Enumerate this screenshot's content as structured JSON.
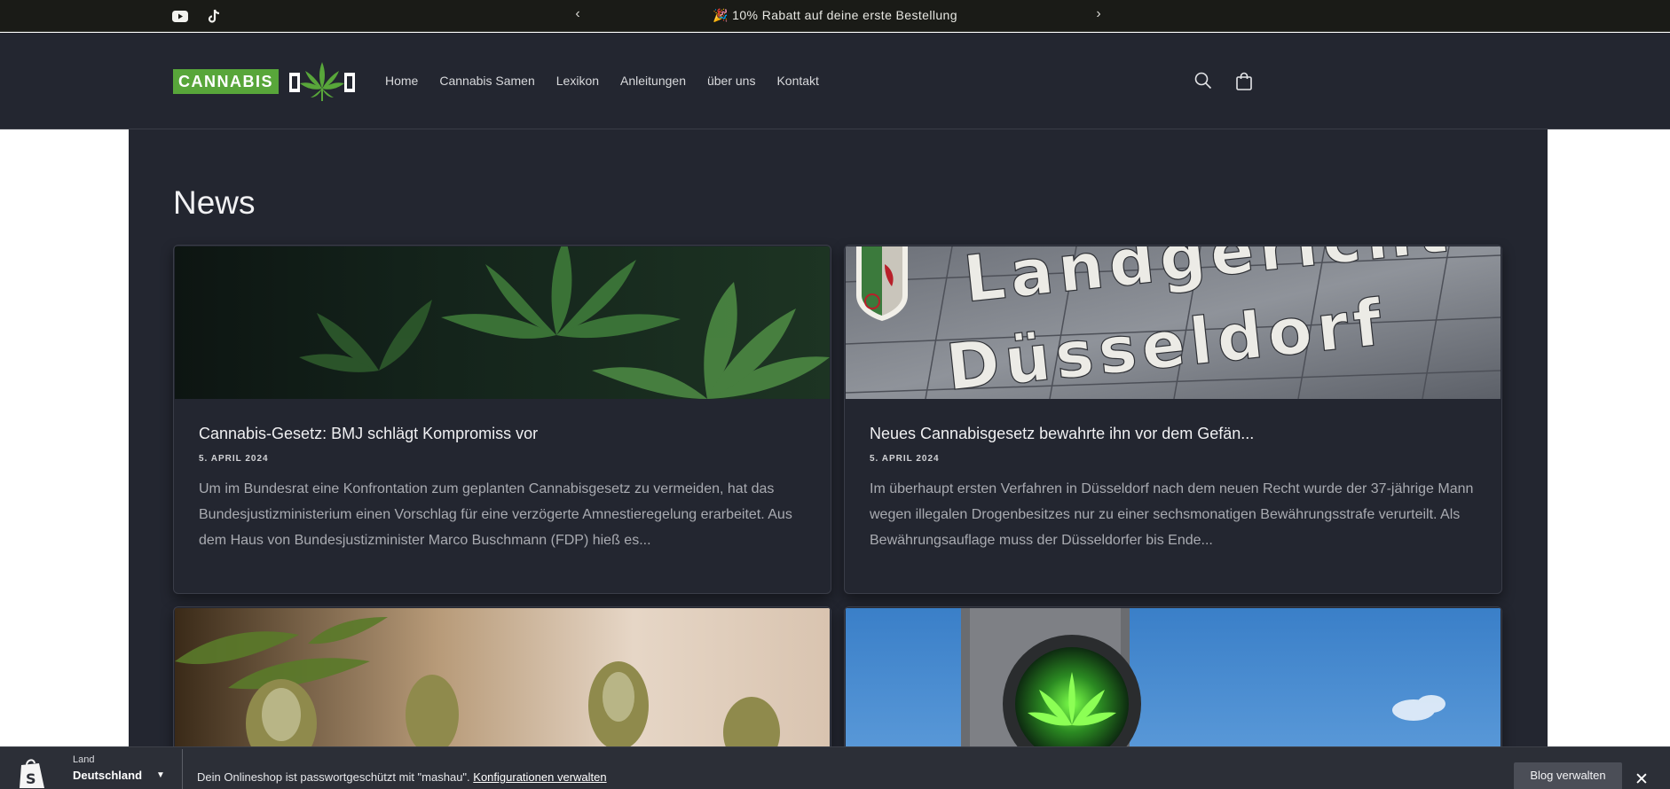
{
  "announcement": {
    "message": "🎉 10% Rabatt auf deine erste Bestellung",
    "prev_arrow": "‹",
    "next_arrow": "›",
    "social_icons": [
      "youtube-icon",
      "tiktok-icon"
    ]
  },
  "header": {
    "logo_text": "CANNABIS",
    "nav": [
      "Home",
      "Cannabis Samen",
      "Lexikon",
      "Anleitungen",
      "über uns",
      "Kontakt"
    ],
    "icons": [
      "search-icon",
      "cart-icon"
    ],
    "brand_color": "#58a63a"
  },
  "main": {
    "title": "News",
    "articles": [
      {
        "title": "Cannabis-Gesetz: BMJ schlägt Kompromiss vor",
        "date": "5. APRIL 2024",
        "excerpt": "Um im Bundesrat eine Konfrontation zum geplanten Cannabisgesetz zu vermeiden, hat das Bundesjustizministerium einen Vorschlag für eine verzögerte Amnestieregelung erarbeitet. Aus dem Haus von Bundesjustizminister Marco Buschmann (FDP) hieß es..."
      },
      {
        "title": "Neues Cannabisgesetz bewahrte ihn vor dem Gefän...",
        "date": "5. APRIL 2024",
        "excerpt": "Im überhaupt ersten Verfahren in Düsseldorf nach dem neuen Recht wurde der 37-jährige Mann wegen illegalen Drogenbesitzes nur zu einer sechsmonatigen Bewährungsstrafe verurteilt. Als Bewährungsauflage muss der Düsseldorfer bis Ende...",
        "image_text_line1": "Landgericht",
        "image_text_line2": "Düsseldorf"
      },
      {
        "title": "",
        "date": "",
        "excerpt": ""
      },
      {
        "title": "",
        "date": "",
        "excerpt": ""
      }
    ]
  },
  "shopify_bar": {
    "land_label": "Land",
    "country": "Deutschland",
    "password_text": "Dein Onlineshop ist passwortgeschützt mit \"mashau\".",
    "config_link": "Konfigurationen verwalten",
    "blog_button": "Blog verwalten",
    "close": "✕"
  }
}
